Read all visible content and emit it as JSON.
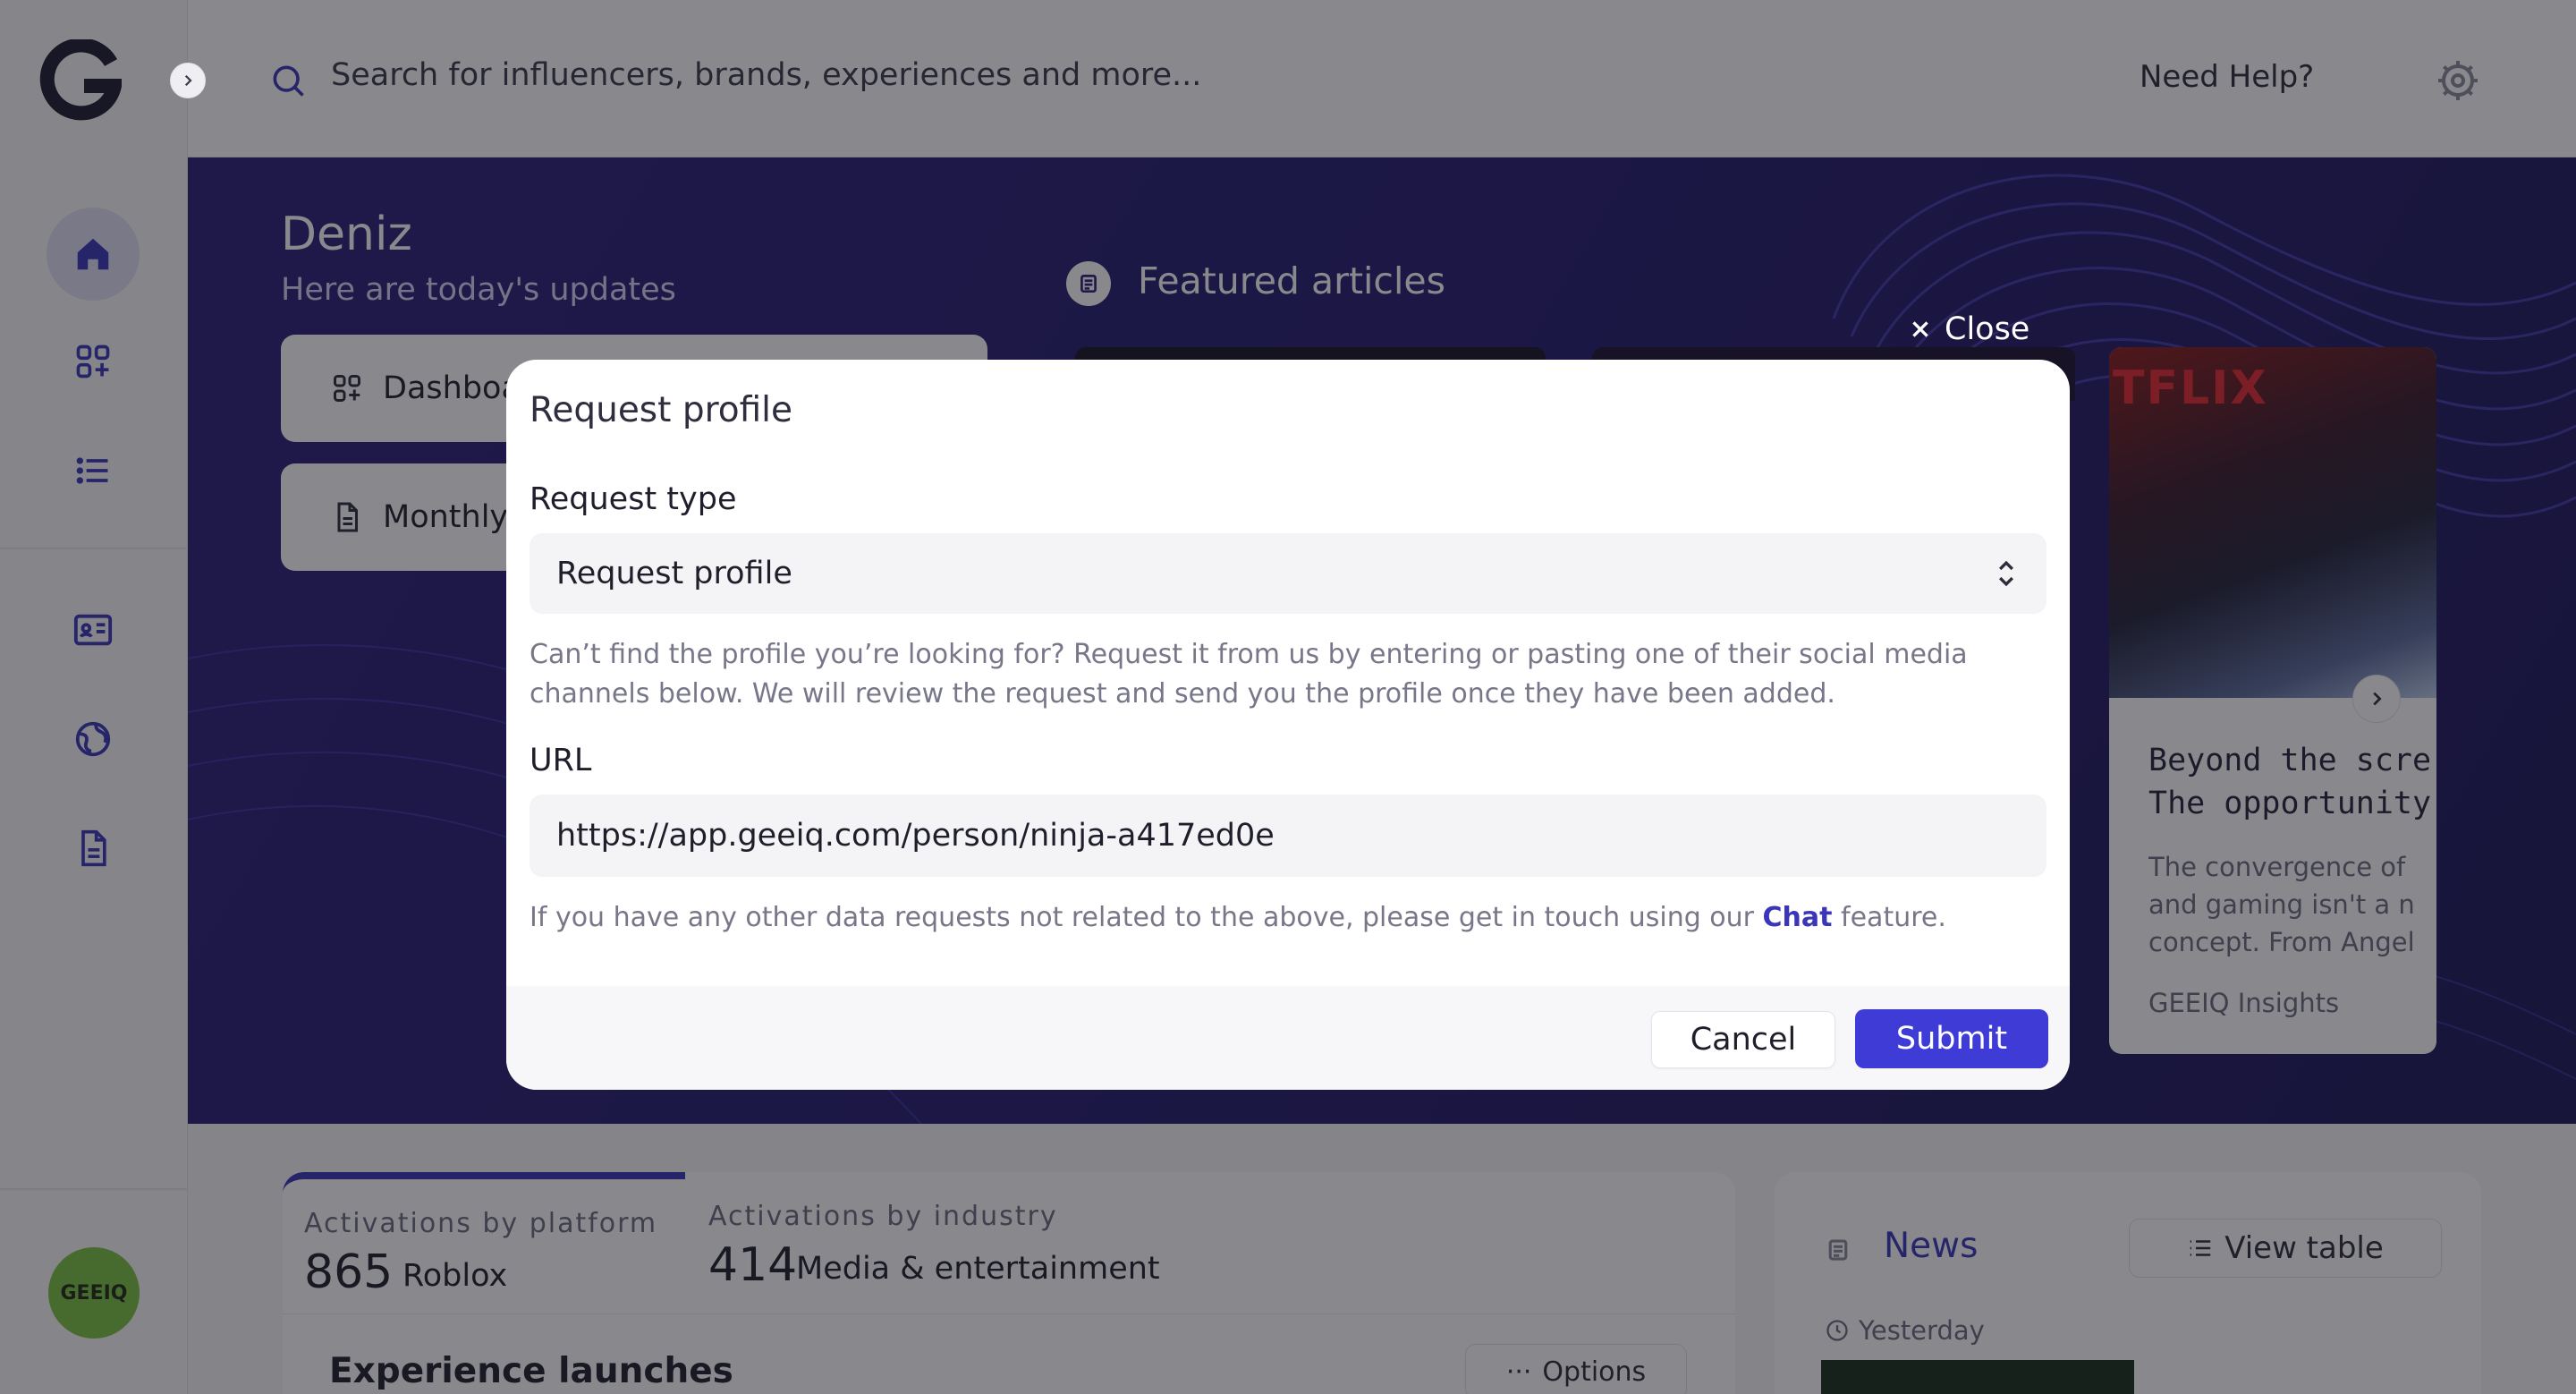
{
  "sidebar": {
    "logo_letter": "G",
    "items": [
      {
        "icon": "home-icon"
      },
      {
        "icon": "grid-add-icon"
      },
      {
        "icon": "list-icon"
      },
      {
        "icon": "id-card-icon"
      },
      {
        "icon": "globe-icon"
      },
      {
        "icon": "document-icon"
      }
    ],
    "avatar_label": "GEEIQ"
  },
  "topbar": {
    "search_placeholder": "Search for influencers, brands, experiences and more...",
    "help_label": "Need Help?"
  },
  "hero": {
    "name": "Deniz",
    "subtitle": "Here are today's updates",
    "buttons": [
      {
        "label": "Dashboa",
        "icon": "grid-add-icon"
      },
      {
        "label": "Monthly",
        "icon": "document-icon"
      }
    ],
    "featured_title": "Featured articles",
    "article": {
      "image_text": "TFLIX",
      "title_line1": "Beyond the scre",
      "title_line2": "The opportunity",
      "body_line1": "The convergence of",
      "body_line2": "and gaming isn't a n",
      "body_line3": "concept. From Angel",
      "source": "GEEIQ Insights"
    }
  },
  "stats": {
    "platform": {
      "label": "Activations by platform",
      "value": "865",
      "unit": "Roblox"
    },
    "industry": {
      "label": "Activations by industry",
      "value": "414",
      "unit": "Media & entertainment"
    },
    "launch_title": "Experience launches",
    "options_label": "Options"
  },
  "news": {
    "title": "News",
    "view_table_label": "View table",
    "date_label": "Yesterday"
  },
  "modal": {
    "close_label": "Close",
    "title": "Request profile",
    "request_type_label": "Request type",
    "request_type_value": "Request profile",
    "helper_text": "Can’t find the profile you’re looking for? Request it from us by entering or pasting one of their social media channels below. We will review the request and send you the profile once they have been added.",
    "url_label": "URL",
    "url_value": "https://app.geeiq.com/person/ninja-a417ed0e",
    "footer_note_before": "If you have any other data requests not related to the above, please get in touch using our ",
    "footer_note_link": "Chat",
    "footer_note_after": " feature.",
    "cancel_label": "Cancel",
    "submit_label": "Submit"
  },
  "colors": {
    "accent": "#3f3bd6",
    "hero_bg": "#241b6e",
    "avatar_bg": "#7bc043"
  }
}
